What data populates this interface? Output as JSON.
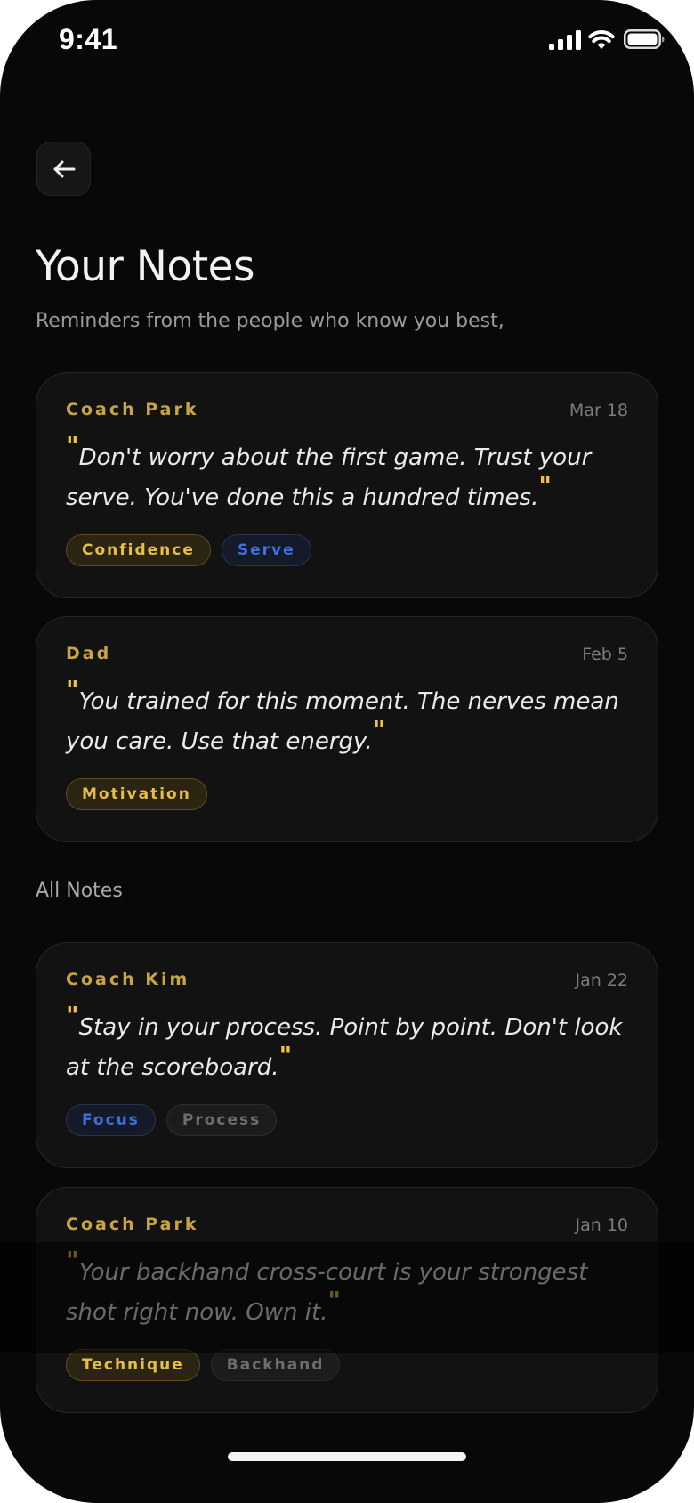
{
  "status_bar": {
    "time": "9:41"
  },
  "header": {
    "back_icon": "arrow-left-icon",
    "title": "Your Notes",
    "subtitle": "Reminders from the people who know you best,"
  },
  "colors": {
    "background": "#080808",
    "card": "#121212",
    "accent_gold": "#f0c345",
    "accent_blue": "#3f6fe0"
  },
  "featured_notes": [
    {
      "author": "Coach Park",
      "date": "Mar 18",
      "quote": "Don't worry about the first game. Trust your serve. You've done this a hundred times.",
      "tags": [
        {
          "label": "Confidence",
          "color": "gold"
        },
        {
          "label": "Serve",
          "color": "blue"
        }
      ]
    },
    {
      "author": "Dad",
      "date": "Feb 5",
      "quote": "You trained for this moment. The nerves mean you care. Use that energy.",
      "tags": [
        {
          "label": "Motivation",
          "color": "gold"
        }
      ]
    }
  ],
  "all_notes": {
    "label": "All Notes",
    "items": [
      {
        "author": "Coach Kim",
        "date": "Jan 22",
        "quote": "Stay in your process. Point by point. Don't look at the scoreboard.",
        "tags": [
          {
            "label": "Focus",
            "color": "blue"
          },
          {
            "label": "Process",
            "color": "gray"
          }
        ]
      },
      {
        "author": "Coach Park",
        "date": "Jan 10",
        "quote": "Your backhand cross-court is your strongest shot right now. Own it.",
        "tags": [
          {
            "label": "Technique",
            "color": "gold"
          },
          {
            "label": "Backhand",
            "color": "gray"
          }
        ]
      }
    ]
  }
}
